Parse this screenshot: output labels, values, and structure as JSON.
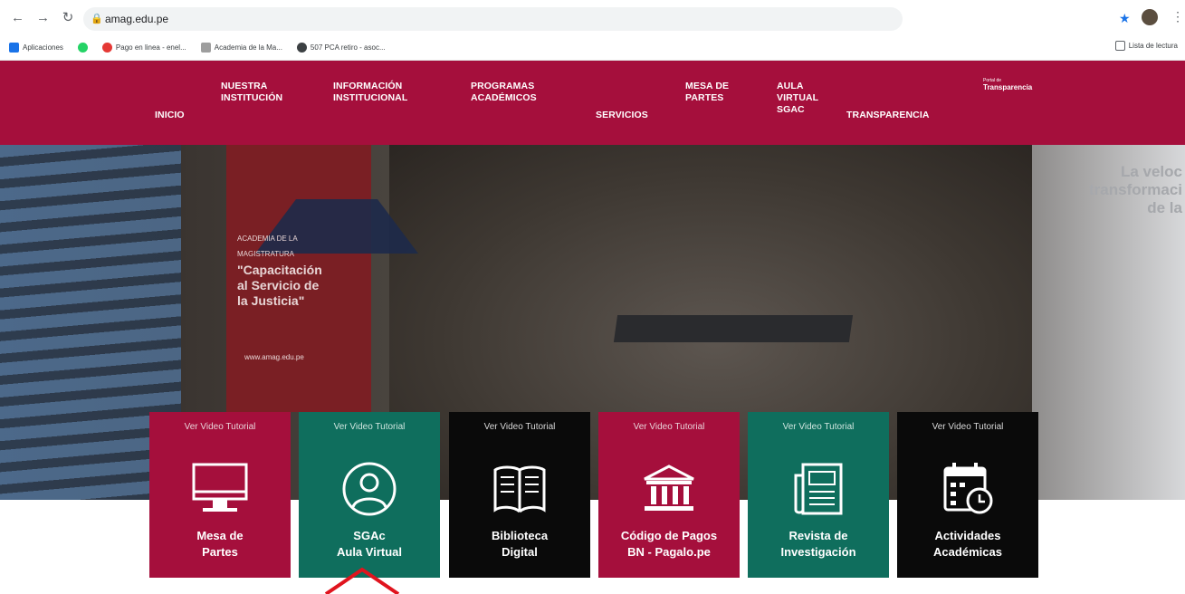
{
  "browser": {
    "url": "amag.edu.pe",
    "bookmarks": [
      {
        "label": "Aplicaciones",
        "color": "#1a73e8"
      },
      {
        "label": "",
        "color": "#25d366"
      },
      {
        "label": "Pago en linea - enel...",
        "color": "#e53935"
      },
      {
        "label": "Academia de la Ma...",
        "color": "#9e9e9e"
      },
      {
        "label": "507 PCA retiro - asoc...",
        "color": "#3c4043"
      }
    ],
    "reading_list": "Lista de lectura"
  },
  "nav": {
    "items": [
      {
        "label": "INICIO"
      },
      {
        "label": "NUESTRA\nINSTITUCIÓN"
      },
      {
        "label": "INFORMACIÓN\nINSTITUCIONAL"
      },
      {
        "label": "PROGRAMAS\nACADÉMICOS"
      },
      {
        "label": "SERVICIOS"
      },
      {
        "label": "MESA DE\nPARTES"
      },
      {
        "label": "AULA\nVIRTUAL\nSGAC"
      },
      {
        "label": "TRANSPARENCIA"
      }
    ],
    "transparency_small": "Portal de",
    "transparency_big": "Transparencia"
  },
  "hero": {
    "banner_top": "ACADEMIA DE LA\nMAGISTRATURA",
    "banner_quote": "\"Capacitación\nal Servicio de\nla Justicia\"",
    "banner_url": "www.amag.edu.pe",
    "right_text": "La veloc\ntransformaci\nde la"
  },
  "tiles": [
    {
      "tutorial": "Ver Video Tutorial",
      "label": "Mesa de\nPartes",
      "color": "#a50f3c",
      "icon": "monitor-icon"
    },
    {
      "tutorial": "Ver Video Tutorial",
      "label": "SGAc\nAula Virtual",
      "color": "#0f6e5d",
      "icon": "user-icon"
    },
    {
      "tutorial": "Ver Video Tutorial",
      "label": "Biblioteca\nDigital",
      "color": "#0a0a0a",
      "icon": "book-icon"
    },
    {
      "tutorial": "Ver Video Tutorial",
      "label": "Código de Pagos\nBN - Pagalo.pe",
      "color": "#a50f3c",
      "icon": "bank-icon"
    },
    {
      "tutorial": "Ver Video Tutorial",
      "label": "Revista de\nInvestigación",
      "color": "#0f6e5d",
      "icon": "newspaper-icon"
    },
    {
      "tutorial": "Ver Video Tutorial",
      "label": "Actividades\nAcadémicas",
      "color": "#0a0a0a",
      "icon": "calendar-icon"
    }
  ]
}
